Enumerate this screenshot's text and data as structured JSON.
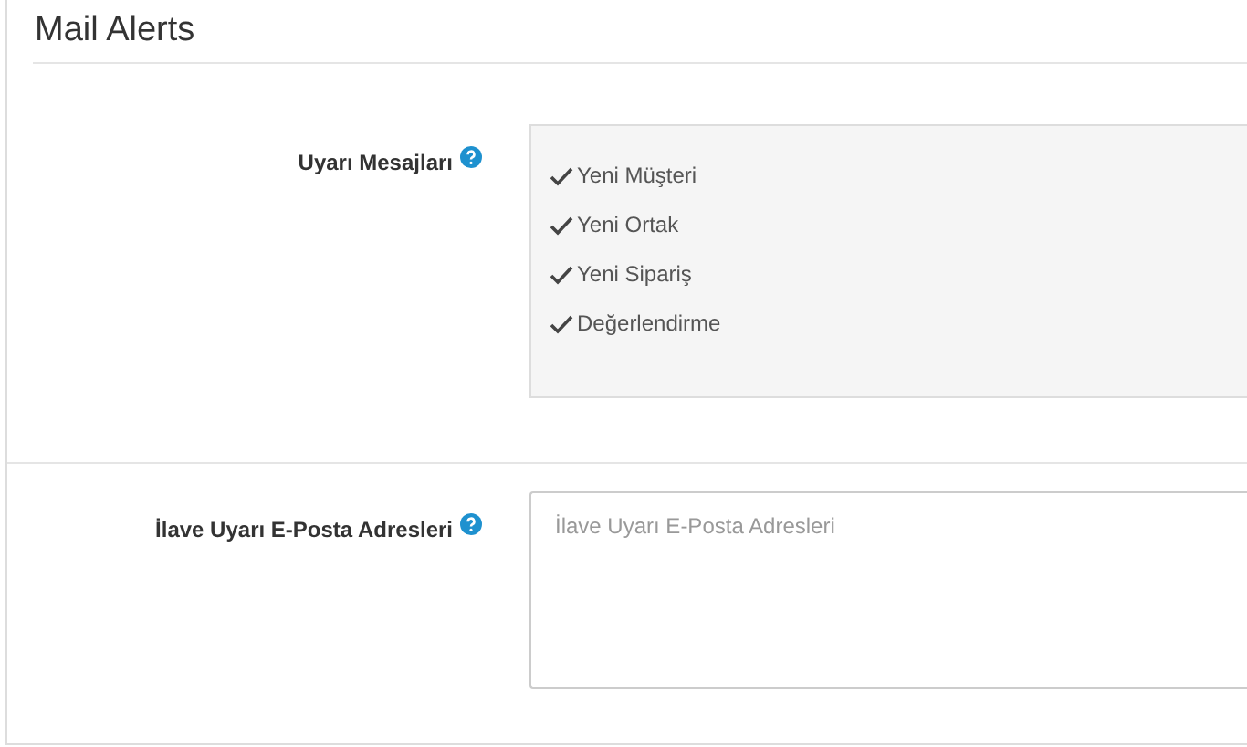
{
  "section": {
    "title": "Mail Alerts"
  },
  "alert_messages": {
    "label": "Uyarı Mesajları",
    "options": [
      {
        "label": "Yeni Müşteri",
        "checked": true
      },
      {
        "label": "Yeni Ortak",
        "checked": true
      },
      {
        "label": "Yeni Sipariş",
        "checked": true
      },
      {
        "label": "Değerlendirme",
        "checked": true
      }
    ]
  },
  "extra_emails": {
    "label": "İlave Uyarı E-Posta Adresleri",
    "placeholder": "İlave Uyarı E-Posta Adresleri"
  }
}
